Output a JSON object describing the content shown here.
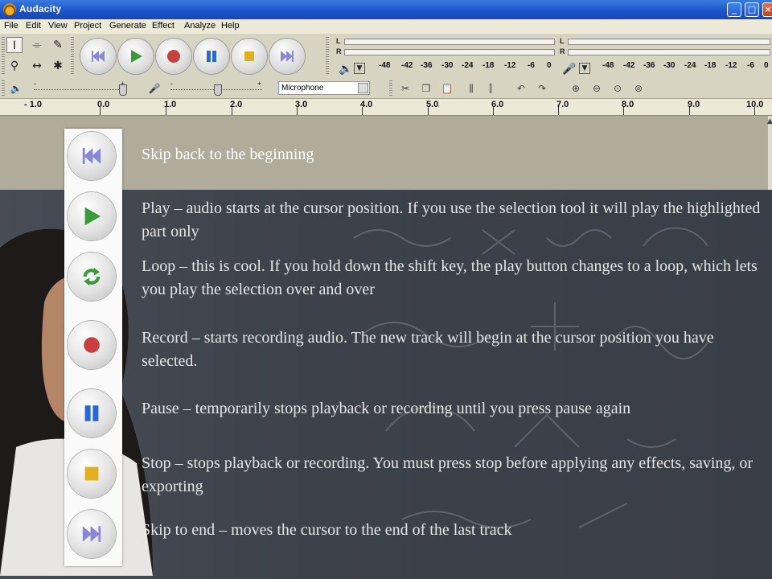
{
  "window": {
    "title": "Audacity"
  },
  "menu": [
    "File",
    "Edit",
    "View",
    "Project",
    "Generate",
    "Effect",
    "Analyze",
    "Help"
  ],
  "meters": {
    "left_channel": "L",
    "right_channel": "R",
    "scale": [
      "-48",
      "-42",
      "-36",
      "-30",
      "-24",
      "-18",
      "-12",
      "-6",
      "0"
    ]
  },
  "mixer": {
    "minus": "-",
    "plus": "+",
    "input_source": "Microphone"
  },
  "ruler": [
    "- 1.0",
    "0.0",
    "1.0",
    "2.0",
    "3.0",
    "4.0",
    "5.0",
    "6.0",
    "7.0",
    "8.0",
    "9.0",
    "10.0"
  ],
  "descriptions": {
    "skip_start": "Skip back to the beginning",
    "play": "Play – audio starts at the cursor position. If you use the selection tool it will play the highlighted part only",
    "loop": "Loop – this is cool. If you hold down the shift key, the play button changes to a loop, which lets you play the selection over and over",
    "record": "Record – starts recording audio. The new track will begin at the cursor position you have selected.",
    "pause": "Pause – temporarily stops playback or recording until you press pause again",
    "stop": "Stop – stops playback or recording. You must press stop before applying any effects, saving, or exporting",
    "skip_end": "Skip to end – moves the cursor to the end of the last track"
  },
  "colors": {
    "transport_purple": "#8a86d8",
    "play_green": "#3c9a3c",
    "record_red": "#c84040",
    "pause_blue": "#2a6ad0",
    "stop_yellow": "#e0b020",
    "skip_start_text": "#ffffff",
    "description_text": "#e6e6e6"
  }
}
